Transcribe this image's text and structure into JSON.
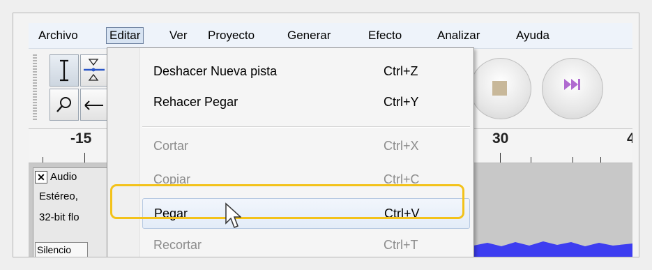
{
  "menubar": {
    "items": [
      "Archivo",
      "Editar",
      "Ver",
      "Proyecto",
      "Generar",
      "Efecto",
      "Analizar",
      "Ayuda"
    ],
    "open_item": "Editar"
  },
  "ruler": {
    "labels": [
      "-15",
      "30",
      "4"
    ]
  },
  "track": {
    "name": "Audio",
    "info": [
      "Estéreo,",
      "32-bit flo"
    ],
    "silence_button": "Silencio"
  },
  "edit_menu": {
    "items": [
      {
        "label": "Deshacer Nueva pista",
        "shortcut": "Ctrl+Z",
        "enabled": true
      },
      {
        "label": "Rehacer Pegar",
        "shortcut": "Ctrl+Y",
        "enabled": true
      },
      {
        "label": "Cortar",
        "shortcut": "Ctrl+X",
        "enabled": false
      },
      {
        "label": "Copiar",
        "shortcut": "Ctrl+C",
        "enabled": false
      },
      {
        "label": "Pegar",
        "shortcut": "Ctrl+V",
        "enabled": true,
        "highlighted": true
      },
      {
        "label": "Recortar",
        "shortcut": "Ctrl+T",
        "enabled": false
      }
    ]
  },
  "colors": {
    "highlight_ring": "#f3c21a",
    "waveform": "#3d3df0",
    "stop_button": "#c8b89a",
    "skip_button": "#b06ad0"
  },
  "icons": [
    "select-tool-icon",
    "envelope-tool-icon",
    "zoom-tool-icon",
    "timeshift-tool-icon",
    "stop-icon",
    "skip-to-end-icon",
    "mouse-pointer-icon"
  ]
}
